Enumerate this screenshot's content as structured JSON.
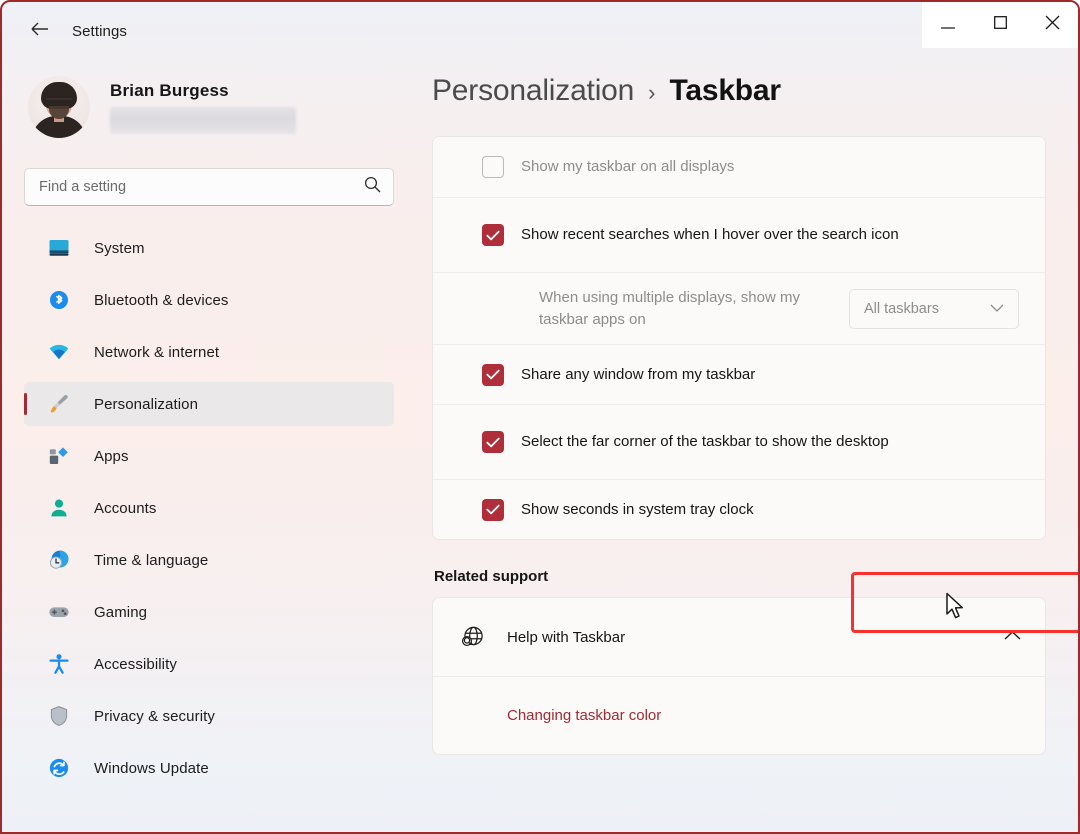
{
  "window": {
    "app_title": "Settings",
    "back_icon": "back-arrow-icon",
    "controls": {
      "minimize": "minimize-icon",
      "maximize": "maximize-icon",
      "close": "close-icon"
    },
    "accent_red": "#b02d3a",
    "highlight_red": "#f8312f",
    "border_red": "#9e2a2b"
  },
  "sidebar": {
    "user": {
      "name": "Brian Burgess",
      "email_redacted": true
    },
    "search": {
      "placeholder": "Find a setting",
      "value": "",
      "icon": "search-icon"
    },
    "items": [
      {
        "label": "System",
        "icon": "monitor-icon",
        "selected": false
      },
      {
        "label": "Bluetooth & devices",
        "icon": "bluetooth-icon",
        "selected": false
      },
      {
        "label": "Network & internet",
        "icon": "wifi-icon",
        "selected": false
      },
      {
        "label": "Personalization",
        "icon": "paintbrush-icon",
        "selected": true
      },
      {
        "label": "Apps",
        "icon": "apps-icon",
        "selected": false
      },
      {
        "label": "Accounts",
        "icon": "person-icon",
        "selected": false
      },
      {
        "label": "Time & language",
        "icon": "clock-globe-icon",
        "selected": false
      },
      {
        "label": "Gaming",
        "icon": "gamepad-icon",
        "selected": false
      },
      {
        "label": "Accessibility",
        "icon": "accessibility-icon",
        "selected": false
      },
      {
        "label": "Privacy & security",
        "icon": "shield-icon",
        "selected": false
      },
      {
        "label": "Windows Update",
        "icon": "update-icon",
        "selected": false
      }
    ]
  },
  "main": {
    "breadcrumb": {
      "parent": "Personalization",
      "separator": "›",
      "current": "Taskbar"
    },
    "settings_rows": [
      {
        "label": "Show my taskbar on all displays",
        "control": "checkbox",
        "checked": false,
        "disabled": true
      },
      {
        "label": "Show recent searches when I hover over the search icon",
        "control": "checkbox",
        "checked": true,
        "disabled": false
      },
      {
        "label": "When using multiple displays, show my taskbar apps on",
        "control": "dropdown",
        "dropdown_value": "All taskbars",
        "dropdown_icon": "chevron-down-icon",
        "disabled": true
      },
      {
        "label": "Share any window from my taskbar",
        "control": "checkbox",
        "checked": true,
        "disabled": false
      },
      {
        "label": "Select the far corner of the taskbar to show the desktop",
        "control": "checkbox",
        "checked": true,
        "disabled": false
      },
      {
        "label": "Show seconds in system tray clock",
        "control": "checkbox",
        "checked": true,
        "disabled": false,
        "highlighted": true
      }
    ],
    "related_support": {
      "title": "Related support",
      "help_row": {
        "label": "Help with Taskbar",
        "icon": "help-globe-icon",
        "chevron": "chevron-up-icon",
        "expanded": true
      },
      "links": [
        {
          "label": "Changing taskbar color"
        }
      ]
    }
  }
}
